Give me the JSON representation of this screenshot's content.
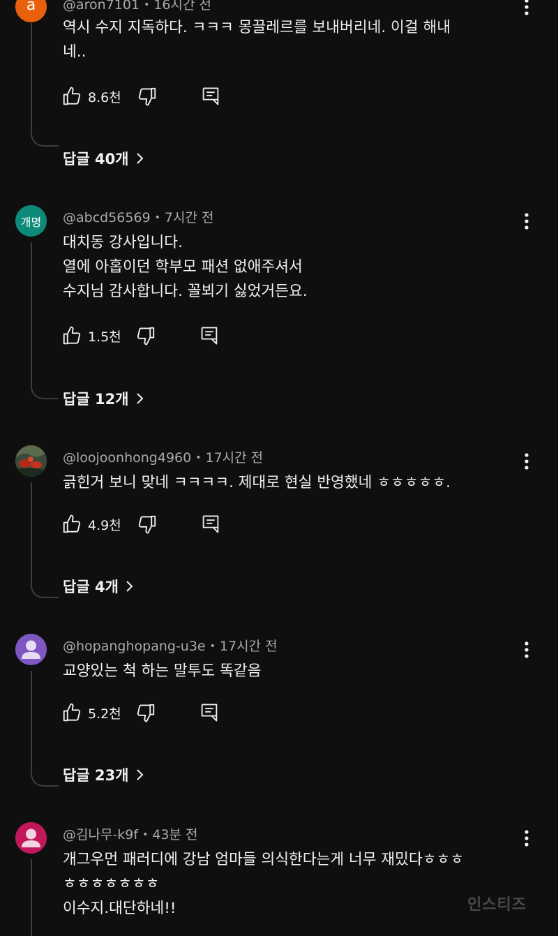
{
  "comments": [
    {
      "handle": "@aron7101",
      "time": "16시간 전",
      "avatar_text": "a",
      "avatar_color": "#e8600c",
      "lines": [
        "역시 수지 지독하다. ㅋㅋㅋ 몽끌레르를 보내버리네.  이걸 해내",
        "네.."
      ],
      "likes": "8.6천",
      "replies": "답글 40개"
    },
    {
      "handle": "@abcd56569",
      "time": "7시간 전",
      "avatar_text": "개명",
      "avatar_color": "#0e8a79",
      "lines": [
        "대치동 강사입니다.",
        "열에 아홉이던 학부모 패션 없애주셔서",
        "수지님 감사합니다. 꼴뵈기 싫었거든요."
      ],
      "likes": "1.5천",
      "replies": "답글 12개"
    },
    {
      "handle": "@loojoonhong4960",
      "time": "17시간 전",
      "avatar_text": "",
      "avatar_color": "#2b3a2c",
      "lines": [
        "긁힌거 보니 맞네 ㅋㅋㅋㅋ. 제대로 현실 반영했네 ㅎㅎㅎㅎㅎ."
      ],
      "likes": "4.9천",
      "replies": "답글 4개"
    },
    {
      "handle": "@hopanghopang-u3e",
      "time": "17시간 전",
      "avatar_text": "",
      "avatar_color": "#7e57c2",
      "lines": [
        "교양있는 척 하는 말투도 똑같음"
      ],
      "likes": "5.2천",
      "replies": "답글 23개"
    },
    {
      "handle": "@김나무-k9f",
      "time": "43분 전",
      "avatar_text": "",
      "avatar_color": "#c2185b",
      "lines": [
        "개그우먼  패러디에 강남 엄마들 의식한다는게 너무 재밌다ㅎㅎㅎ",
        "ㅎㅎㅎㅎㅎㅎㅎ",
        "이수지.대단하네!!"
      ],
      "likes": "",
      "replies": ""
    }
  ],
  "watermark": "인스티즈",
  "icons": {
    "like": "thumbs-up-icon",
    "dislike": "thumbs-down-icon",
    "reply": "reply-comment-icon",
    "more": "more-vert-icon",
    "chevron": "chevron-right-icon"
  }
}
